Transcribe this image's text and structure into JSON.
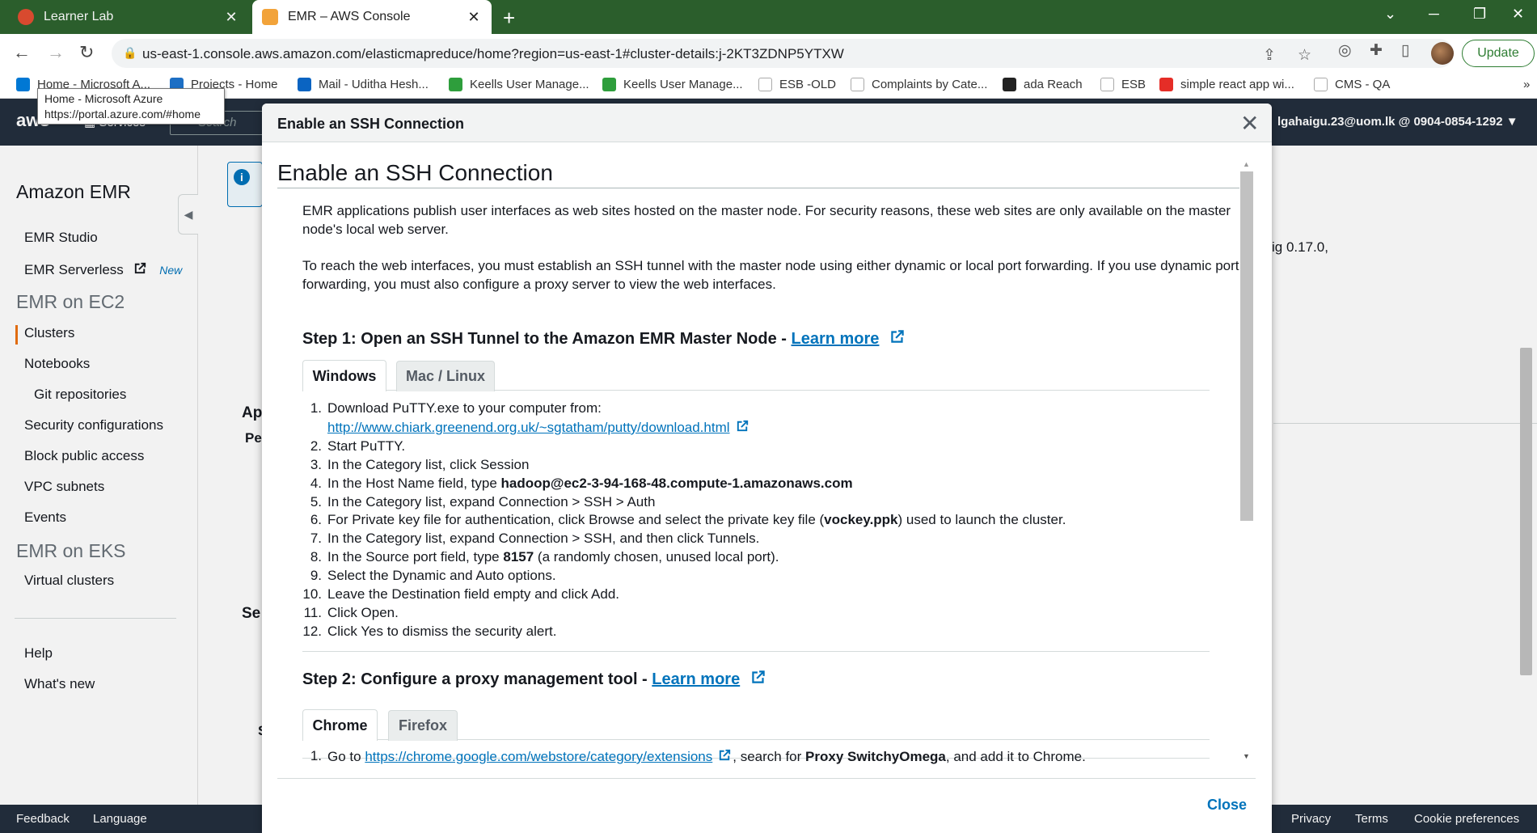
{
  "browser": {
    "tabs": [
      {
        "title": "Learner Lab",
        "active": false
      },
      {
        "title": "EMR – AWS Console",
        "active": true
      }
    ],
    "url": "us-east-1.console.aws.amazon.com/elasticmapreduce/home?region=us-east-1#cluster-details:j-2KT3ZDNP5YTXW",
    "update_label": "Update",
    "bookmarks": [
      "Home - Microsoft A...",
      "Projects - Home",
      "Mail - Uditha Hesh...",
      "Keells User Manage...",
      "Keells User Manage...",
      "ESB -OLD",
      "Complaints by Cate...",
      "ada Reach",
      "ESB",
      "simple react app wi...",
      "CMS - QA"
    ],
    "tooltip": {
      "title": "Home - Microsoft Azure",
      "url": "https://portal.azure.com/#home"
    }
  },
  "aws_header": {
    "logo": "aws",
    "services_label": "Services",
    "search_placeholder": "Search",
    "account": "lgahaigu.23@uom.lk @ 0904-0854-1292 ▼"
  },
  "sidebar": {
    "title": "Amazon EMR",
    "items": {
      "emr_studio": "EMR Studio",
      "emr_serverless": "EMR Serverless",
      "new_tag": "New",
      "section_ec2": "EMR on EC2",
      "clusters": "Clusters",
      "notebooks": "Notebooks",
      "git_repositories": "Git repositories",
      "security_configurations": "Security configurations",
      "block_public_access": "Block public access",
      "vpc_subnets": "VPC subnets",
      "events": "Events",
      "section_eks": "EMR on EKS",
      "virtual_clusters": "Virtual clusters",
      "help": "Help",
      "whats_new": "What's new"
    }
  },
  "background": {
    "fragment_version": "ig 0.17.0,",
    "fragment_ap": "Ap",
    "fragment_pe": "Pe",
    "fragment_se": "Se",
    "fragment_s": "S"
  },
  "footer": {
    "feedback": "Feedback",
    "language": "Language",
    "privacy": "Privacy",
    "terms": "Terms",
    "cookies": "Cookie preferences"
  },
  "modal": {
    "header_title": "Enable an SSH Connection",
    "body_title": "Enable an SSH Connection",
    "intro_1": "EMR applications publish user interfaces as web sites hosted on the master node. For security reasons, these web sites are only available on the master node's local web server.",
    "intro_2": "To reach the web interfaces, you must establish an SSH tunnel with the master node using either dynamic or local port forwarding. If you use dynamic port forwarding, you must also configure a proxy server to view the web interfaces.",
    "step1": {
      "heading": "Step 1: Open an SSH Tunnel to the Amazon EMR Master Node - ",
      "learn_more": "Learn more",
      "tabs": [
        "Windows",
        "Mac / Linux"
      ],
      "steps": {
        "s1": "Download PuTTY.exe to your computer from:",
        "s1_link": "http://www.chiark.greenend.org.uk/~sgtatham/putty/download.html",
        "s2": "Start PuTTY.",
        "s3": "In the Category list, click Session",
        "s4_pre": "In the Host Name field, type ",
        "s4_bold": "hadoop@ec2-3-94-168-48.compute-1.amazonaws.com",
        "s5": "In the Category list, expand Connection > SSH > Auth",
        "s6_pre": "For Private key file for authentication, click Browse and select the private key file (",
        "s6_bold": "vockey.ppk",
        "s6_post": ") used to launch the cluster.",
        "s7": "In the Category list, expand Connection > SSH, and then click Tunnels.",
        "s8_pre": "In the Source port field, type ",
        "s8_bold": "8157",
        "s8_post": " (a randomly chosen, unused local port).",
        "s9": "Select the Dynamic and Auto options.",
        "s10": "Leave the Destination field empty and click Add.",
        "s11": "Click Open.",
        "s12": "Click Yes to dismiss the security alert."
      }
    },
    "step2": {
      "heading": "Step 2: Configure a proxy management tool - ",
      "learn_more": "Learn more",
      "tabs": [
        "Chrome",
        "Firefox"
      ],
      "s1_pre": "Go to ",
      "s1_link": "https://chrome.google.com/webstore/category/extensions",
      "s1_mid": ", search for ",
      "s1_bold": "Proxy SwitchyOmega",
      "s1_post": ", and add it to Chrome."
    },
    "close_label": "Close"
  },
  "colors": {
    "tabstrip": "#2b5e2c",
    "aws_header": "#232f3e",
    "link": "#0073bb",
    "active_marker": "#ec7211"
  }
}
